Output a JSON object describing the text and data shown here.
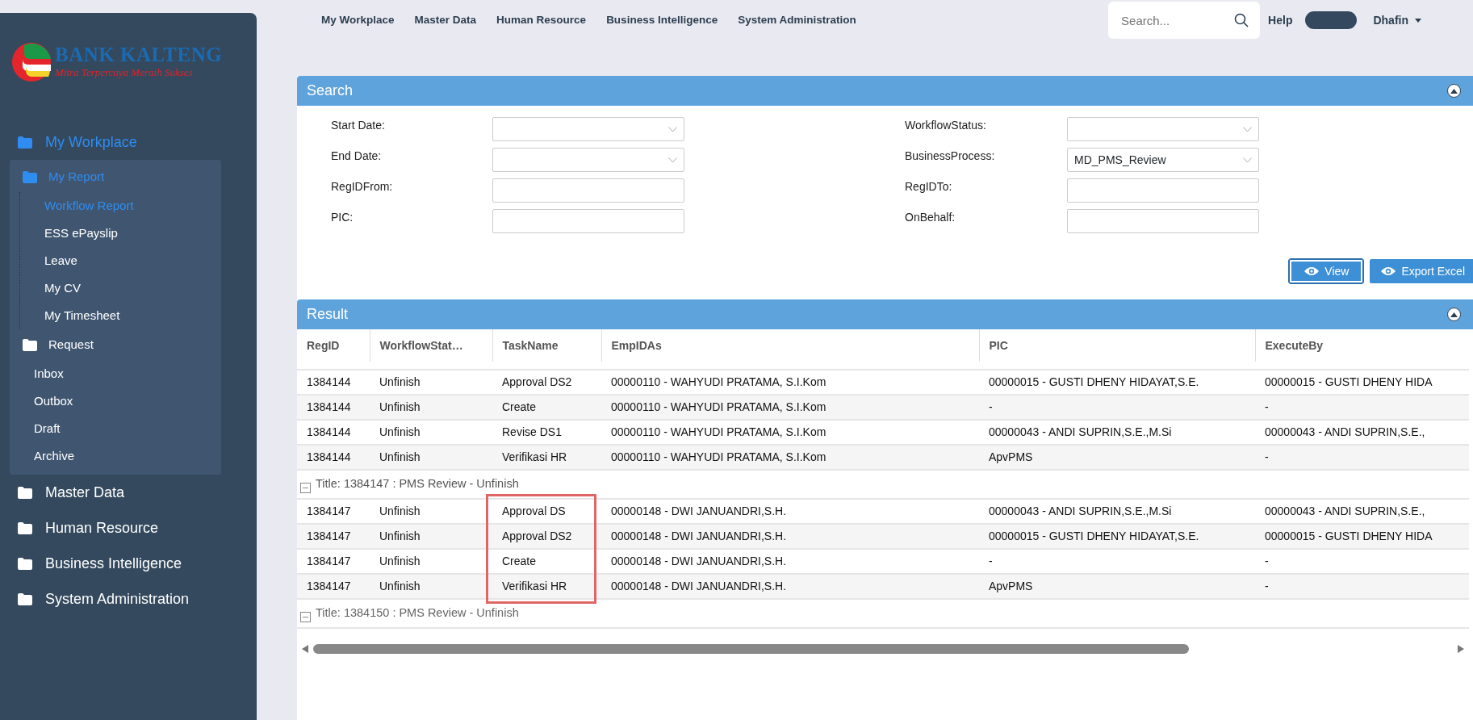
{
  "logo": {
    "name": "BANK KALTENG",
    "tagline": "Mitra Terpercaya Meraih Sukses"
  },
  "sidebar": {
    "items": [
      {
        "label": "My Workplace",
        "selected": true,
        "expanded": true,
        "children": [
          {
            "label": "My Report",
            "selected": true,
            "expanded": true,
            "children": [
              {
                "label": "Workflow Report",
                "selected": true
              },
              {
                "label": "ESS ePayslip",
                "selected": false
              },
              {
                "label": "Leave",
                "selected": false
              },
              {
                "label": "My CV",
                "selected": false
              },
              {
                "label": "My Timesheet",
                "selected": false
              }
            ]
          },
          {
            "label": "Request",
            "selected": false,
            "expanded": true,
            "children": [
              {
                "label": "Inbox",
                "selected": false
              },
              {
                "label": "Outbox",
                "selected": false
              },
              {
                "label": "Draft",
                "selected": false
              },
              {
                "label": "Archive",
                "selected": false
              }
            ]
          }
        ]
      },
      {
        "label": "Master Data",
        "selected": false
      },
      {
        "label": "Human Resource",
        "selected": false
      },
      {
        "label": "Business Intelligence",
        "selected": false
      },
      {
        "label": "System Administration",
        "selected": false
      }
    ]
  },
  "top_menu": [
    "My Workplace",
    "Master Data",
    "Human Resource",
    "Business Intelligence",
    "System Administration"
  ],
  "search": {
    "placeholder": "Search..."
  },
  "help": "Help",
  "user": "Dhafin",
  "search_panel": {
    "title": "Search",
    "fields": [
      {
        "label": "Start Date:",
        "kind": "dropdown"
      },
      {
        "label": "WorkflowStatus:",
        "kind": "dropdown"
      },
      {
        "label": "End Date:",
        "kind": "dropdown"
      },
      {
        "label": "BusinessProcess:",
        "kind": "dropdown",
        "value": "MD_PMS_Review"
      },
      {
        "label": "RegIDFrom:",
        "kind": "text"
      },
      {
        "label": "RegIDTo:",
        "kind": "text"
      },
      {
        "label": "PIC:",
        "kind": "text"
      },
      {
        "label": "OnBehalf:",
        "kind": "text"
      }
    ],
    "buttons": [
      {
        "label": "View",
        "selected": true
      },
      {
        "label": "Export Excel",
        "selected": false
      }
    ]
  },
  "result_panel": {
    "title": "Result",
    "table": {
      "columns": [
        "RegID",
        "WorkflowStat…",
        "TaskName",
        "EmpIDAs",
        "PIC",
        "ExecuteBy"
      ],
      "groups": [
        {
          "rows": [
            [
              "1384144",
              "Unfinish",
              "Approval DS2",
              "00000110 - WAHYUDI PRATAMA, S.I.Kom",
              "00000015 - GUSTI DHENY HIDAYAT,S.E.",
              "00000015 - GUSTI DHENY HIDA"
            ],
            [
              "1384144",
              "Unfinish",
              "Create",
              "00000110 - WAHYUDI PRATAMA, S.I.Kom",
              "-",
              "-"
            ],
            [
              "1384144",
              "Unfinish",
              "Revise DS1",
              "00000110 - WAHYUDI PRATAMA, S.I.Kom",
              "00000043 - ANDI SUPRIN,S.E.,M.Si",
              "00000043 - ANDI SUPRIN,S.E.,"
            ],
            [
              "1384144",
              "Unfinish",
              "Verifikasi HR",
              "00000110 - WAHYUDI PRATAMA, S.I.Kom",
              "ApvPMS",
              "-"
            ]
          ]
        },
        {
          "title": "Title: 1384147 : PMS Review - Unfinish",
          "expanded": true,
          "highlighted": true,
          "rows": [
            [
              "1384147",
              "Unfinish",
              "Approval DS",
              "00000148 - DWI JANUANDRI,S.H.",
              "00000043 - ANDI SUPRIN,S.E.,M.Si",
              "00000043 - ANDI SUPRIN,S.E.,"
            ],
            [
              "1384147",
              "Unfinish",
              "Approval DS2",
              "00000148 - DWI JANUANDRI,S.H.",
              "00000015 - GUSTI DHENY HIDAYAT,S.E.",
              "00000015 - GUSTI DHENY HIDA"
            ],
            [
              "1384147",
              "Unfinish",
              "Create",
              "00000148 - DWI JANUANDRI,S.H.",
              "-",
              "-"
            ],
            [
              "1384147",
              "Unfinish",
              "Verifikasi HR",
              "00000148 - DWI JANUANDRI,S.H.",
              "ApvPMS",
              "-"
            ]
          ]
        },
        {
          "title": "Title: 1384150 : PMS Review - Unfinish",
          "expanded": true,
          "highlighted": false
        }
      ]
    }
  }
}
